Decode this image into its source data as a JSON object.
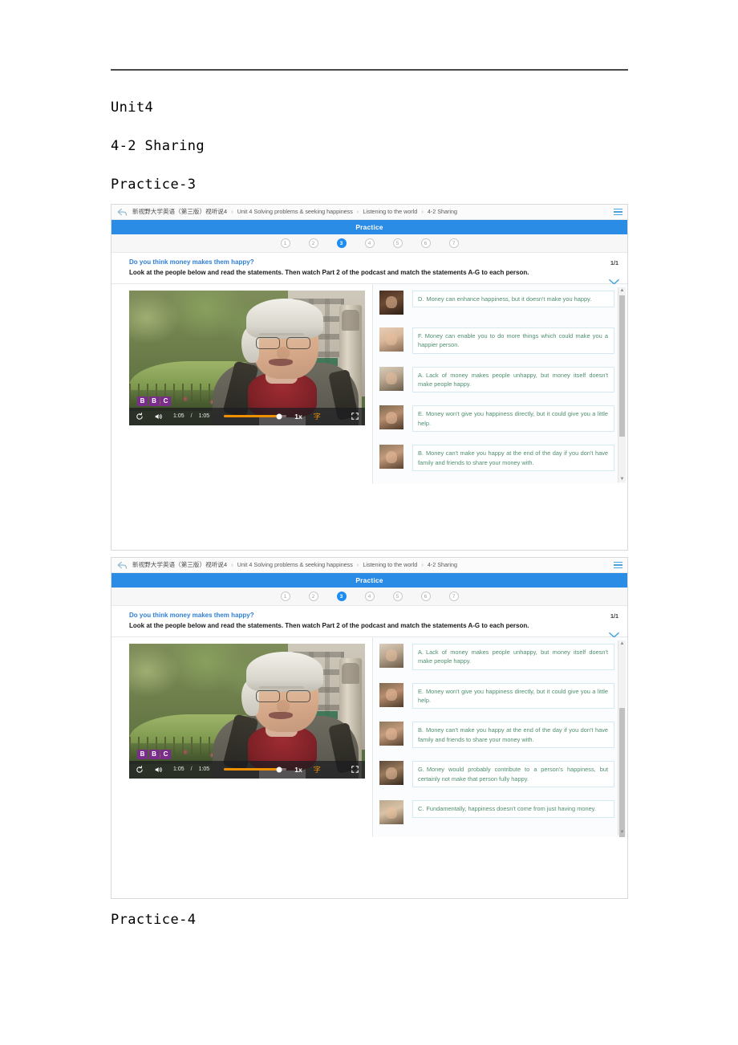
{
  "document": {
    "headings": {
      "unit": "Unit4",
      "section": "4-2 Sharing",
      "practice3": "Practice-3",
      "practice4": "Practice-4"
    }
  },
  "screenshot": {
    "breadcrumb": {
      "back_icon": "back-arrow-icon",
      "items": [
        "新视野大学英语（第三版）视听说4",
        "Unit 4 Solving problems & seeking happiness",
        "Listening to the world",
        "4-2 Sharing"
      ],
      "separator": "›",
      "menu_icon": "hamburger-menu-icon"
    },
    "practice_bar": {
      "label": "Practice"
    },
    "steps": {
      "items": [
        "1",
        "2",
        "3",
        "4",
        "5",
        "6",
        "7"
      ],
      "active": "3"
    },
    "question": {
      "title": "Do you think money makes them happy?",
      "body": "Look at the people below and read the statements. Then watch Part 2 of the podcast and match the statements A-G to each person.",
      "counter": "1/1",
      "collapse_icon": "chevron-down-icon"
    },
    "video": {
      "replay_icon": "replay-icon",
      "volume_icon": "volume-on-icon",
      "current_time": "1:05",
      "time_separator": "/",
      "duration": "1:05",
      "progress_percent": 88,
      "speed": "1x",
      "subtitle_icon": "字",
      "fullscreen_icon": "fullscreen-icon",
      "watermark": [
        "B",
        "B",
        "C"
      ]
    },
    "statements_panel_1": [
      {
        "letter": "D.",
        "text": "Money can enhance happiness, but it doesn't make you happy.",
        "face": "f1"
      },
      {
        "letter": "F.",
        "text": "Money can enable you to do more things which could make you a happier person.",
        "face": "f2"
      },
      {
        "letter": "A.",
        "text": "Lack of money makes people unhappy, but money itself doesn't make people happy.",
        "face": "f3"
      },
      {
        "letter": "E.",
        "text": "Money won't give you happiness directly, but it could give you a little help.",
        "face": "f4"
      },
      {
        "letter": "B.",
        "text": "Money can't make you happy at the end of the day if you don't have family and friends to share your money with.",
        "face": "f5"
      }
    ],
    "statements_panel_2": [
      {
        "letter": "A.",
        "text": "Lack of money makes people unhappy, but money itself doesn't make people happy.",
        "face": "f3"
      },
      {
        "letter": "E.",
        "text": "Money won't give you happiness directly, but it could give you a little help.",
        "face": "f4"
      },
      {
        "letter": "B.",
        "text": "Money can't make you happy at the end of the day if you don't have family and friends to share your money with.",
        "face": "f5"
      },
      {
        "letter": "G.",
        "text": "Money would probably contribute to a person's happiness, but certainly not make that person fully happy.",
        "face": "f6"
      },
      {
        "letter": "C.",
        "text": "Fundamentally, happiness doesn't come from just having money.",
        "face": "f7"
      }
    ],
    "colors": {
      "practice_bar": "#2b8ce5",
      "active_step": "#1f8cf0",
      "question_title": "#2e7fd4",
      "statement_text": "#4e8f6e",
      "statement_border": "#d6e9f3",
      "progress": "#f09000",
      "subtitle": "#f09000"
    }
  }
}
